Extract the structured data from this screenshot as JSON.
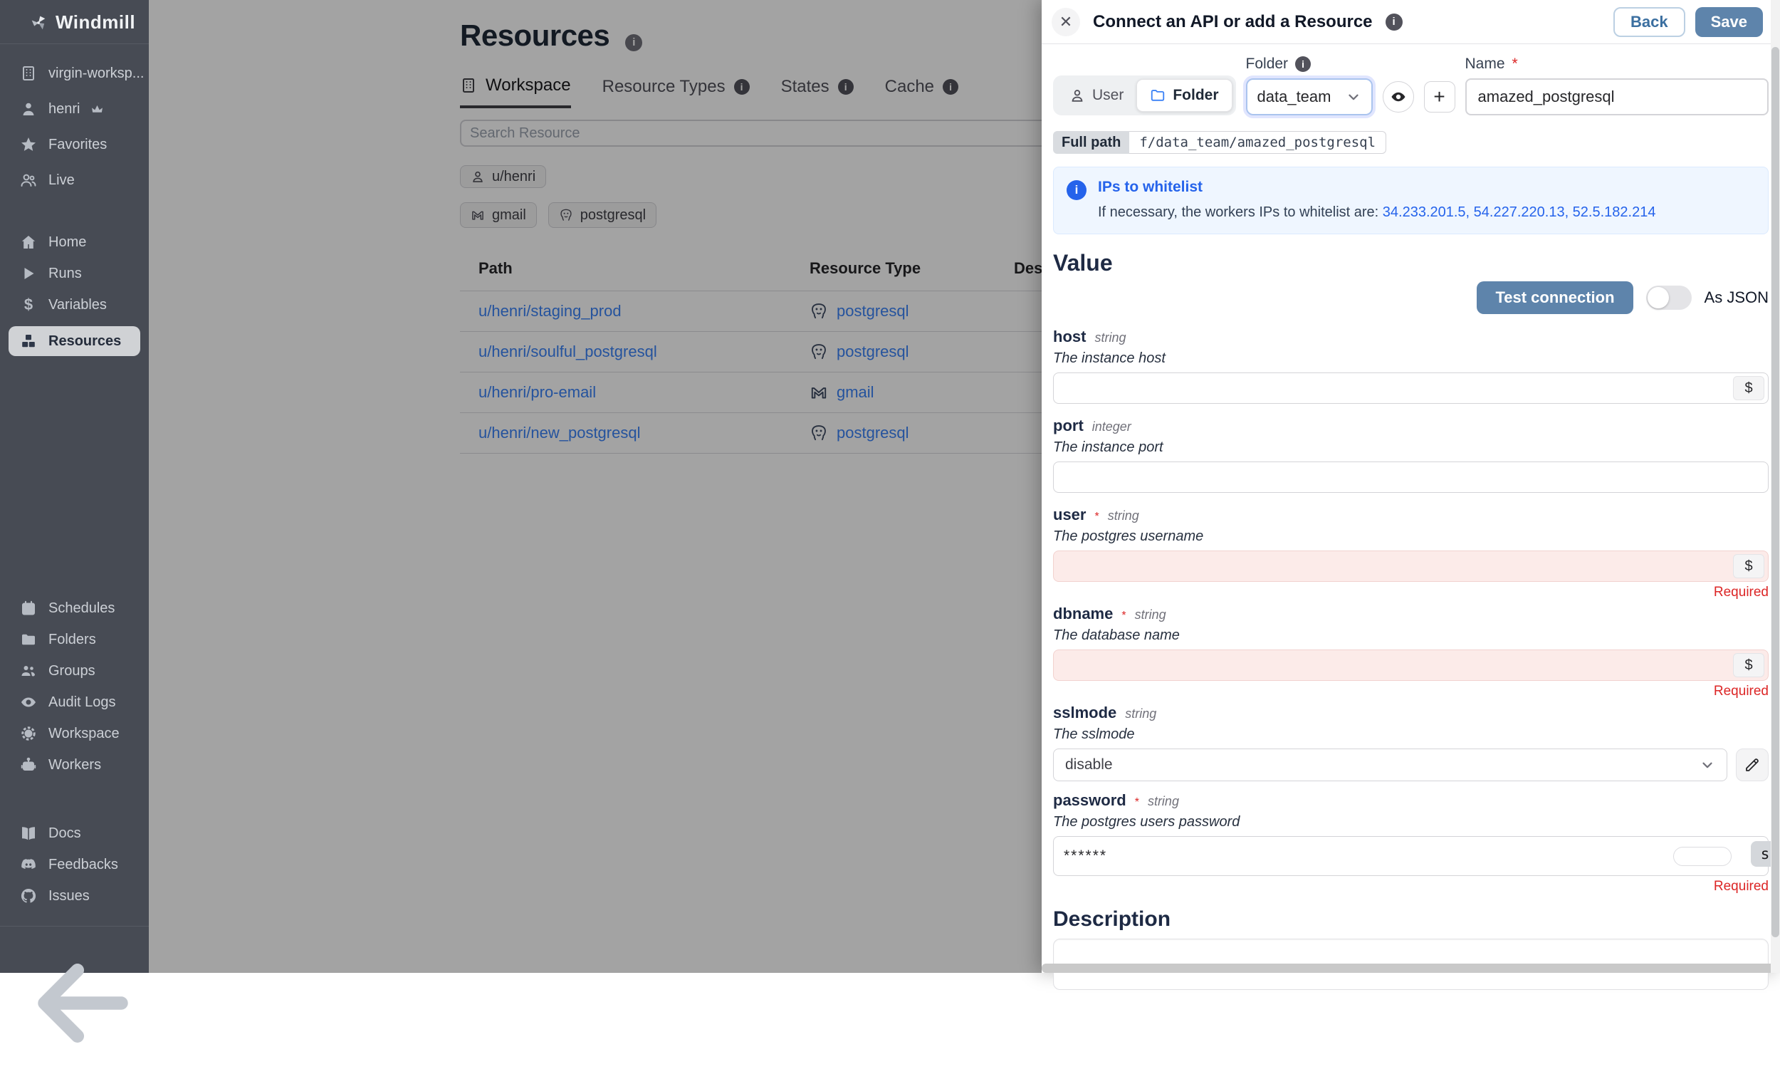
{
  "colors": {
    "accent_blue": "#5e84ab",
    "link_blue": "#3b82f6",
    "info_blue": "#2563eb",
    "sidebar_bg": "#474b54",
    "invalid_bg": "#fcebe9",
    "required_red": "#dc2626"
  },
  "sidebar": {
    "logo": "Windmill",
    "items": [
      {
        "label": "virgin-worksp...",
        "icon": "building"
      },
      {
        "label": "henri",
        "icon": "user"
      },
      {
        "label": "Favorites",
        "icon": "star"
      },
      {
        "label": "Live",
        "icon": "users"
      },
      {
        "label": "Home",
        "icon": "home"
      },
      {
        "label": "Runs",
        "icon": "play"
      },
      {
        "label": "Variables",
        "icon": "dollar"
      },
      {
        "label": "Resources",
        "icon": "boxes"
      },
      {
        "label": "Schedules",
        "icon": "calendar"
      },
      {
        "label": "Folders",
        "icon": "folder"
      },
      {
        "label": "Groups",
        "icon": "group"
      },
      {
        "label": "Audit Logs",
        "icon": "eye"
      },
      {
        "label": "Workspace",
        "icon": "gear"
      },
      {
        "label": "Workers",
        "icon": "robot"
      },
      {
        "label": "Docs",
        "icon": "book"
      },
      {
        "label": "Feedbacks",
        "icon": "discord"
      },
      {
        "label": "Issues",
        "icon": "github"
      }
    ]
  },
  "main": {
    "title": "Resources",
    "tabs": [
      {
        "label": "Workspace",
        "active": true
      },
      {
        "label": "Resource Types",
        "info": true
      },
      {
        "label": "States",
        "info": true
      },
      {
        "label": "Cache",
        "info": true
      }
    ],
    "search_placeholder": "Search Resource",
    "owner_chip": "u/henri",
    "type_chips": [
      {
        "label": "gmail"
      },
      {
        "label": "postgresql"
      }
    ],
    "table": {
      "headers": {
        "path": "Path",
        "type": "Resource Type",
        "desc": "Desc"
      },
      "rows": [
        {
          "path": "u/henri/staging_prod",
          "type": "postgresql"
        },
        {
          "path": "u/henri/soulful_postgresql",
          "type": "postgresql"
        },
        {
          "path": "u/henri/pro-email",
          "type": "gmail"
        },
        {
          "path": "u/henri/new_postgresql",
          "type": "postgresql"
        }
      ]
    }
  },
  "drawer": {
    "title": "Connect an API or add a Resource",
    "back_label": "Back",
    "save_label": "Save",
    "segments": {
      "user": "User",
      "folder": "Folder"
    },
    "folder_label": "Folder",
    "folder_value": "data_team",
    "name_label": "Name",
    "name_required_star": "*",
    "name_value": "amazed_postgresql",
    "plus_label": "+",
    "full_path_label": "Full path",
    "full_path_value": "f/data_team/amazed_postgresql",
    "ips": {
      "title": "IPs to whitelist",
      "body_prefix": "If necessary, the workers IPs to whitelist are: ",
      "ips_list": "34.233.201.5, 54.227.220.13, 52.5.182.214"
    },
    "value_heading": "Value",
    "test_button": "Test connection",
    "as_json_label": "As JSON",
    "dollar_label": "$",
    "required_label": "Required",
    "fields": [
      {
        "name": "host",
        "req": "",
        "type": "string",
        "desc": "The instance host"
      },
      {
        "name": "port",
        "req": "",
        "type": "integer",
        "desc": "The instance port"
      },
      {
        "name": "user",
        "req": "*",
        "type": "string",
        "desc": "The postgres username"
      },
      {
        "name": "dbname",
        "req": "*",
        "type": "string",
        "desc": "The database name"
      },
      {
        "name": "sslmode",
        "req": "",
        "type": "string",
        "desc": "The sslmode",
        "value": "disable"
      },
      {
        "name": "password",
        "req": "*",
        "type": "string",
        "desc": "The postgres users password",
        "value": "******",
        "sh_tag": "sh"
      }
    ],
    "description_heading": "Description"
  }
}
